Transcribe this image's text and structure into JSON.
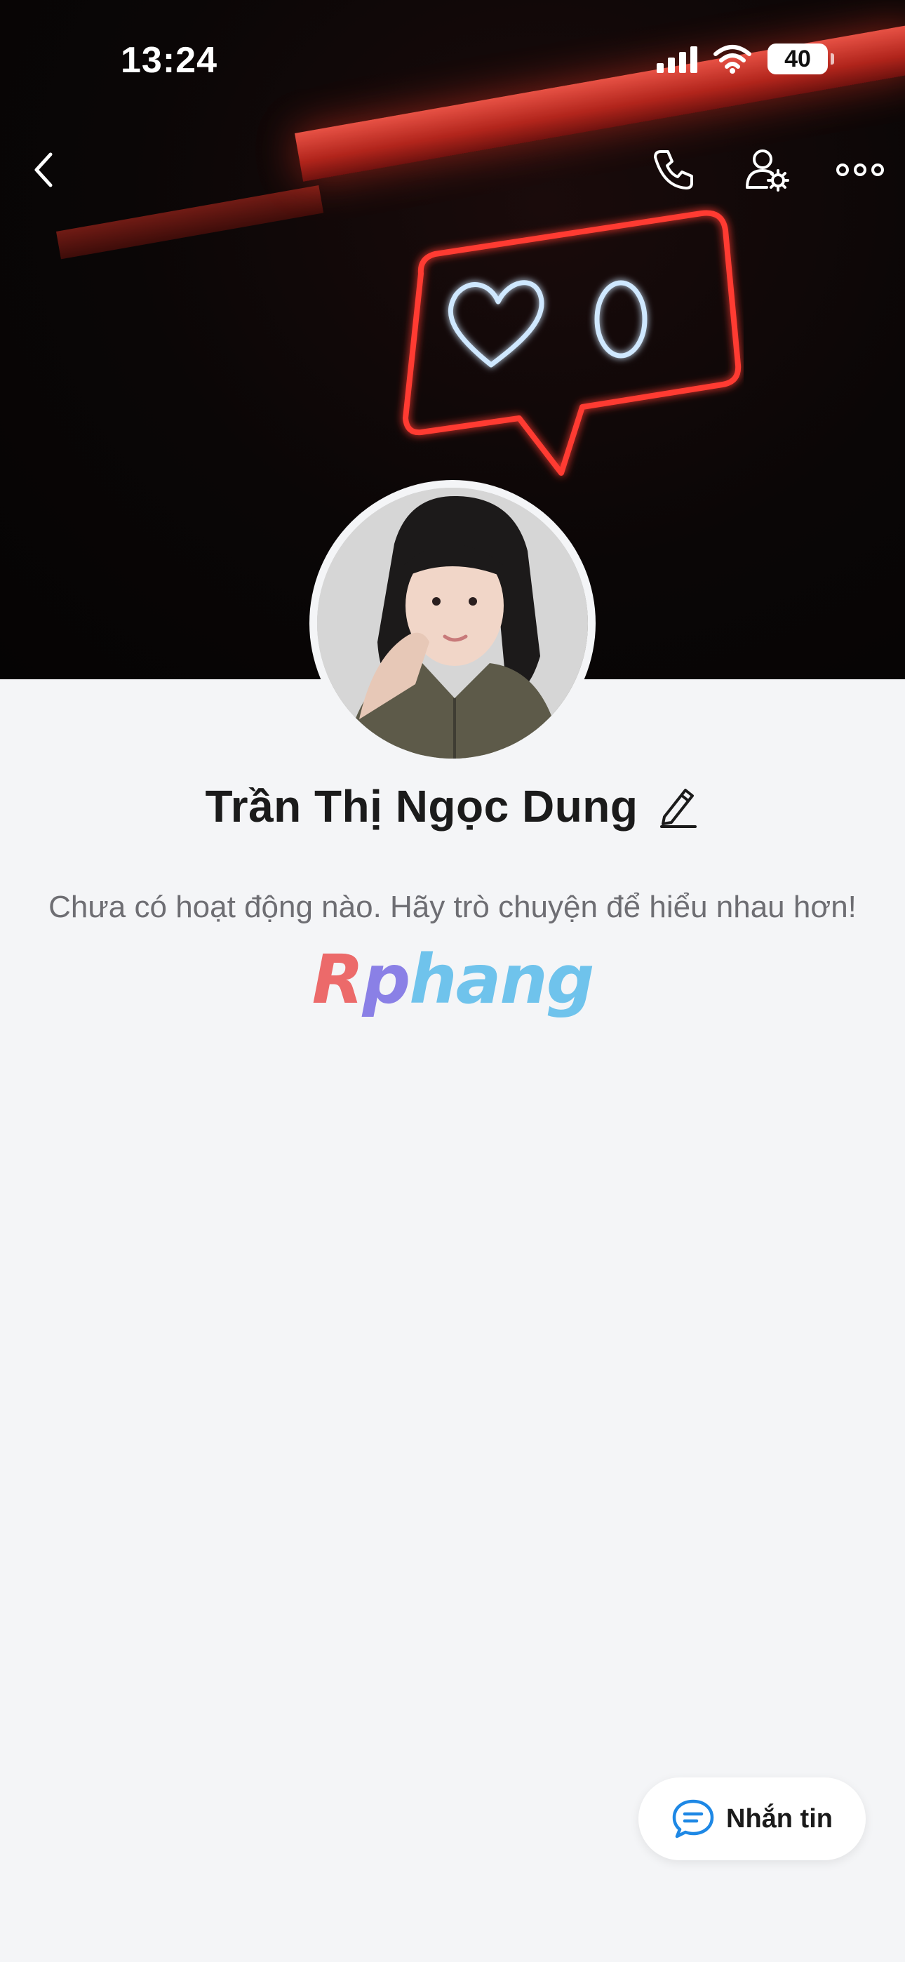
{
  "status_bar": {
    "time": "13:24",
    "battery": "40",
    "icons": [
      "signal-icon",
      "wifi-icon",
      "battery-icon"
    ]
  },
  "nav": {
    "icons": [
      "back-icon",
      "phone-icon",
      "user-settings-icon",
      "more-icon"
    ]
  },
  "profile": {
    "name": "Trần Thị Ngọc Dung",
    "edit_icon": "pencil-icon"
  },
  "activity": {
    "empty_message": "Chưa có hoạt động nào. Hãy trò chuyện để hiểu nhau hơn!"
  },
  "watermark": {
    "text": "Rphang"
  },
  "message_button": {
    "label": "Nhắn tin",
    "icon": "chat-icon"
  },
  "colors": {
    "background": "#f4f5f7",
    "neon_red": "#ff3b30",
    "neon_blue": "#cfe8ff",
    "chat_icon_blue": "#1e88e5"
  }
}
